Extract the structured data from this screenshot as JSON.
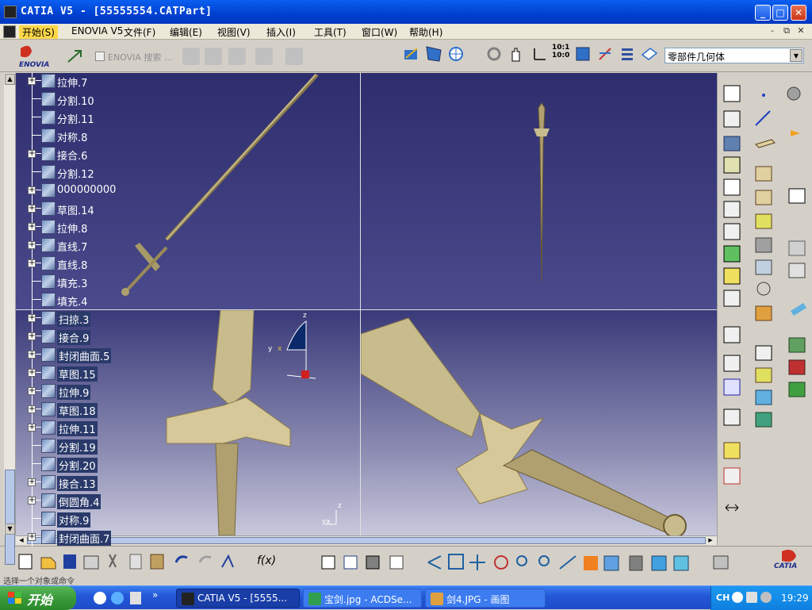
{
  "window": {
    "title": "CATIA V5 - [55555554.CATPart]",
    "min_label": "_",
    "max_label": "□",
    "close_label": "✕"
  },
  "menu": {
    "items": [
      {
        "label": "开始(S)"
      },
      {
        "label": "ENOVIA V5"
      },
      {
        "label": "文件(F)"
      },
      {
        "label": "编辑(E)"
      },
      {
        "label": "视图(V)"
      },
      {
        "label": "插入(I)"
      },
      {
        "label": "工具(T)"
      },
      {
        "label": "窗口(W)"
      },
      {
        "label": "帮助(H)"
      }
    ],
    "mdi": [
      "-",
      "⧉",
      "✕"
    ]
  },
  "toolbar": {
    "enovia_label": "ENOVIA",
    "search_label": "ENOVIA 搜索 ...",
    "zoom_label": "10:1\n10:0",
    "body_select": "零部件几何体"
  },
  "tree": {
    "items": [
      {
        "label": "拉伸.7",
        "exp": true
      },
      {
        "label": "分割.10",
        "exp": false
      },
      {
        "label": "分割.11",
        "exp": false
      },
      {
        "label": "对称.8",
        "exp": false
      },
      {
        "label": "接合.6",
        "exp": true
      },
      {
        "label": "分割.12",
        "exp": false
      },
      {
        "label": "000000000",
        "exp": true
      },
      {
        "label": "草图.14",
        "exp": true
      },
      {
        "label": "拉伸.8",
        "exp": true
      },
      {
        "label": "直线.7",
        "exp": true
      },
      {
        "label": "直线.8",
        "exp": true
      },
      {
        "label": "填充.3",
        "exp": false
      },
      {
        "label": "填充.4",
        "exp": false
      },
      {
        "label": "扫掠.3",
        "exp": true
      },
      {
        "label": "接合.9",
        "exp": true
      },
      {
        "label": "封闭曲面.5",
        "exp": true
      },
      {
        "label": "草图.15",
        "exp": true
      },
      {
        "label": "拉伸.9",
        "exp": true
      },
      {
        "label": "草图.18",
        "exp": true
      },
      {
        "label": "拉伸.11",
        "exp": true
      },
      {
        "label": "分割.19",
        "exp": false
      },
      {
        "label": "分割.20",
        "exp": false
      },
      {
        "label": "接合.13",
        "exp": true
      },
      {
        "label": "倒圆角.4",
        "exp": true
      },
      {
        "label": "对称.9",
        "exp": false
      },
      {
        "label": "封闭曲面.7",
        "exp": true
      }
    ]
  },
  "compass": {
    "x": "x",
    "y": "y",
    "z": "z"
  },
  "axis_mini": {
    "label": "yx",
    "z": "z"
  },
  "status": {
    "text": "选择一个对象或命令"
  },
  "taskbar": {
    "start_label": "开始",
    "chevron": "»",
    "tasks": [
      {
        "label": "CATIA V5 - [5555..."
      },
      {
        "label": "宝剑.jpg - ACDSe..."
      },
      {
        "label": "剑4.JPG - 画图"
      }
    ],
    "tray_lang": "CH",
    "clock": "19:29"
  },
  "colors": {
    "viewport_top": "#3a3a7a",
    "viewport_bottom": "#c8c8dc",
    "sword": "#c8bc8c",
    "title_blue": "#0a5ff0"
  }
}
